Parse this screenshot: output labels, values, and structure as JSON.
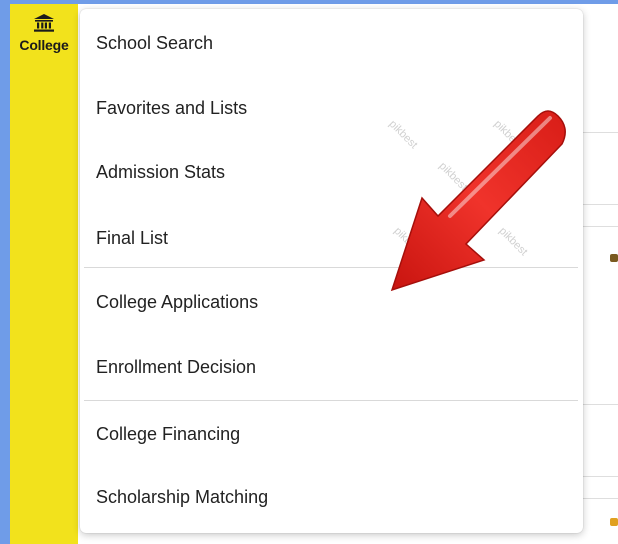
{
  "sidebar": {
    "college_label": "College",
    "icon": "bank-icon"
  },
  "menu": {
    "items": [
      {
        "label": "School Search"
      },
      {
        "label": "Favorites and Lists"
      },
      {
        "label": "Admission Stats"
      },
      {
        "label": "Final List"
      },
      {
        "label": "College Applications"
      },
      {
        "label": "Enrollment Decision"
      },
      {
        "label": "College Financing"
      },
      {
        "label": "Scholarship Matching"
      }
    ]
  },
  "watermark_text": "pikbest",
  "colors": {
    "page_background": "#6f9ce8",
    "sidebar": "#f2e21c",
    "arrow": "#e0221c"
  }
}
